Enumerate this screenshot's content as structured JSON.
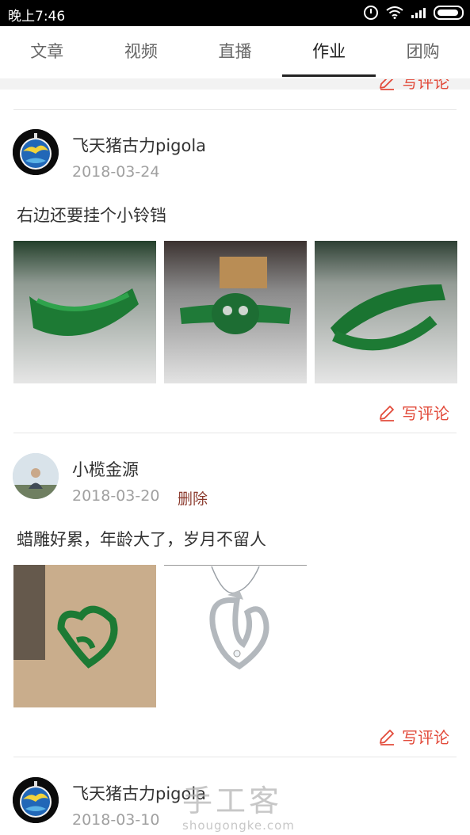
{
  "status_bar": {
    "time": "晚上7:46"
  },
  "tabs": [
    {
      "label": "文章",
      "active": false
    },
    {
      "label": "视频",
      "active": false
    },
    {
      "label": "直播",
      "active": false
    },
    {
      "label": "作业",
      "active": true
    },
    {
      "label": "团购",
      "active": false
    }
  ],
  "comment_label": "写评论",
  "posts": [
    {
      "username": "飞天猪古力pigola",
      "date": "2018-03-24",
      "text": "右边还要挂个小铃铛",
      "comment_label": "写评论"
    },
    {
      "username": "小榄金源",
      "date": "2018-03-20",
      "delete_label": "删除",
      "text": "蜡雕好累，年龄大了，岁月不留人",
      "comment_label": "写评论"
    },
    {
      "username": "飞天猪古力pigola",
      "date": "2018-03-10"
    }
  ],
  "watermark": {
    "title": "手工客",
    "domain": "shougongke.com"
  },
  "colors": {
    "accent": "#e24b3b",
    "delete": "#8b3a2d"
  }
}
